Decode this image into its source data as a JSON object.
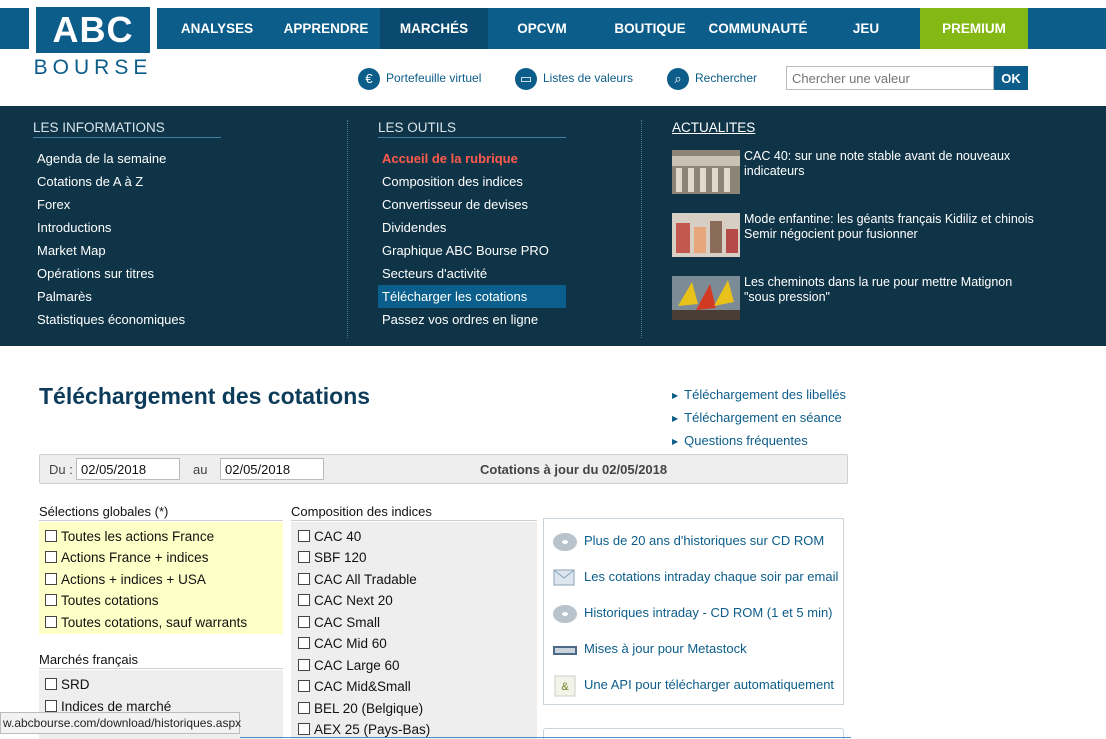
{
  "logo": {
    "top": "ABC",
    "bottom": "BOURSE"
  },
  "nav": [
    {
      "label": "ANALYSES"
    },
    {
      "label": "APPRENDRE"
    },
    {
      "label": "MARCHÉS"
    },
    {
      "label": "OPCVM"
    },
    {
      "label": "BOUTIQUE"
    },
    {
      "label": "COMMUNAUTÉ"
    },
    {
      "label": "JEU"
    },
    {
      "label": "PREMIUM"
    }
  ],
  "tools": {
    "portefeuille": "Portefeuille virtuel",
    "listes": "Listes de valeurs",
    "rechercher": "Rechercher",
    "search_placeholder": "Chercher une valeur",
    "ok": "OK"
  },
  "menu": {
    "info_title": "LES INFORMATIONS",
    "info_links": [
      "Agenda de la semaine",
      "Cotations de A à Z",
      "Forex",
      "Introductions",
      "Market Map",
      "Opérations sur titres",
      "Palmarès",
      "Statistiques économiques"
    ],
    "outils_title": "LES OUTILS",
    "outils_links": [
      "Accueil de la rubrique",
      "Composition des indices",
      "Convertisseur de devises",
      "Dividendes",
      "Graphique ABC Bourse PRO",
      "Secteurs d'activité",
      "Télécharger les cotations",
      "Passez vos ordres en ligne"
    ],
    "news_title": "ACTUALITES",
    "news": [
      "CAC 40: sur une note stable avant de nouveaux indicateurs",
      "Mode enfantine: les géants français Kidiliz et chinois Semir négocient pour fusionner",
      "Les cheminots dans la rue pour mettre Matignon \"sous pression\""
    ]
  },
  "content": {
    "title": "Téléchargement des cotations",
    "side_links": [
      "Téléchargement des libellés",
      "Téléchargement en séance",
      "Questions fréquentes"
    ],
    "du_label": "Du :",
    "du_value": "02/05/2018",
    "au_label": "au",
    "au_value": "02/05/2018",
    "maj": "Cotations à jour du 02/05/2018",
    "globales_title": "Sélections globales (*)",
    "globales": [
      "Toutes les actions France",
      "Actions France + indices",
      "Actions + indices + USA",
      "Toutes cotations",
      "Toutes cotations, sauf warrants"
    ],
    "marches_title": "Marchés français",
    "marches": [
      "SRD",
      "Indices de marché"
    ],
    "indices_title": "Composition des indices",
    "indices": [
      "CAC 40",
      "SBF 120",
      "CAC All Tradable",
      "CAC Next 20",
      "CAC Small",
      "CAC Mid 60",
      "CAC Large 60",
      "CAC Mid&Small",
      "BEL 20 (Belgique)",
      "AEX 25 (Pays-Bas)"
    ],
    "promos": [
      "Plus de 20 ans d'historiques sur CD ROM",
      "Les cotations intraday chaque soir par email",
      "Historiques intraday - CD ROM (1 et 5 min)",
      "Mises à jour pour Metastock",
      "Une API pour télécharger automatiquement"
    ]
  },
  "status_url": "w.abcbourse.com/download/historiques.aspx",
  "colors": {
    "brand": "#0c5d8a",
    "dark": "#0f3447",
    "premium": "#84b814",
    "accent_red": "#ff5a4d"
  }
}
